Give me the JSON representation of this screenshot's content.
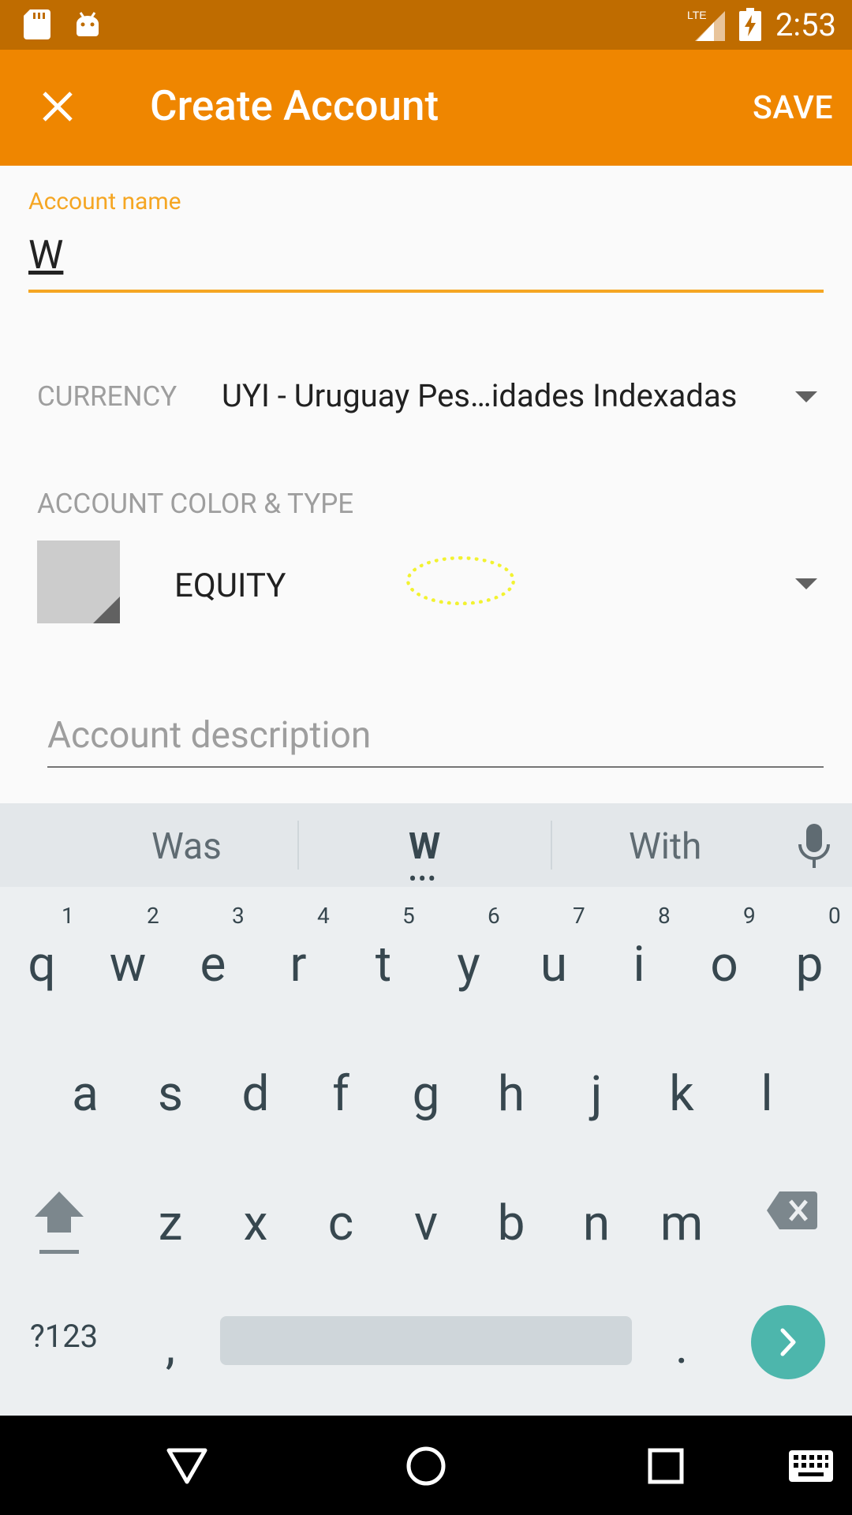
{
  "status_bar": {
    "time": "2:53",
    "network": "LTE",
    "icons": [
      "sd-card-icon",
      "android-icon",
      "signal-icon",
      "battery-charging-icon"
    ]
  },
  "toolbar": {
    "title": "Create Account",
    "close_icon": "close-icon",
    "save_label": "SAVE"
  },
  "form": {
    "account_name_label": "Account name",
    "account_name_value": "W",
    "currency_label": "CURRENCY",
    "currency_value": "UYI - Uruguay Pes…idades Indexadas",
    "color_type_label": "ACCOUNT COLOR & TYPE",
    "account_type_value": "EQUITY",
    "account_color": "#cccccc",
    "description_placeholder": "Account description"
  },
  "keyboard": {
    "suggestions": [
      "Was",
      "W",
      "With"
    ],
    "row1": [
      "q",
      "w",
      "e",
      "r",
      "t",
      "y",
      "u",
      "i",
      "o",
      "p"
    ],
    "row1_hints": [
      "1",
      "2",
      "3",
      "4",
      "5",
      "6",
      "7",
      "8",
      "9",
      "0"
    ],
    "row2": [
      "a",
      "s",
      "d",
      "f",
      "g",
      "h",
      "j",
      "k",
      "l"
    ],
    "row3": [
      "z",
      "x",
      "c",
      "v",
      "b",
      "n",
      "m"
    ],
    "symbols_label": "?123",
    "comma": ",",
    "period": "."
  },
  "colors": {
    "status_bar": "#bf6c00",
    "toolbar": "#ef8600",
    "accent": "#f5a623",
    "enter_key": "#4db6ac"
  }
}
